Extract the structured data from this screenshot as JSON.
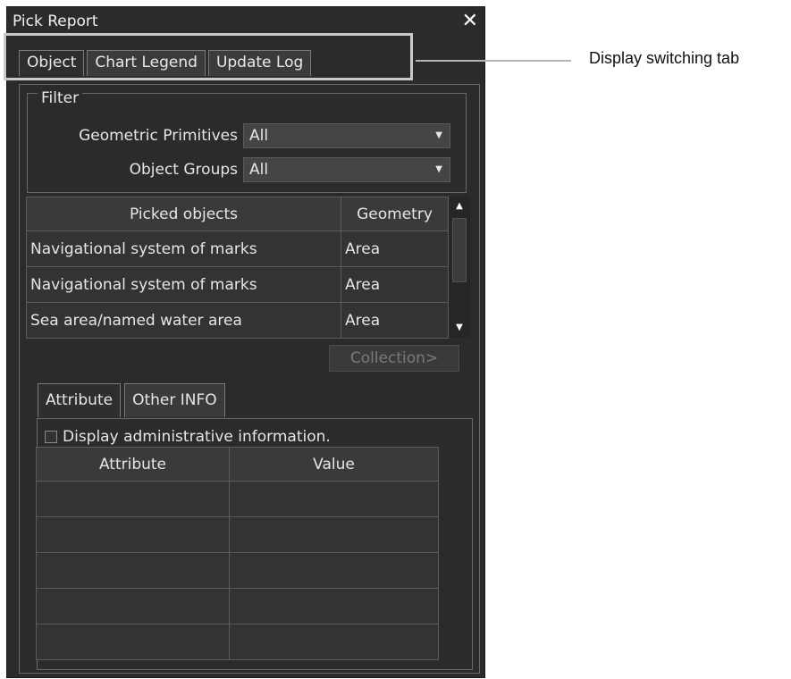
{
  "window": {
    "title": "Pick Report",
    "close_symbol": "✕"
  },
  "top_tabs": [
    {
      "label": "Object",
      "active": true
    },
    {
      "label": "Chart Legend",
      "active": false
    },
    {
      "label": "Update Log",
      "active": false
    }
  ],
  "callout": {
    "text": "Display switching tab"
  },
  "filter": {
    "legend": "Filter",
    "geometric_primitives": {
      "label": "Geometric Primitives",
      "value": "All"
    },
    "object_groups": {
      "label": "Object Groups",
      "value": "All"
    }
  },
  "objects_table": {
    "headers": [
      "Picked objects",
      "Geometry"
    ],
    "rows": [
      [
        "Navigational system of marks",
        "Area"
      ],
      [
        "Navigational system of marks",
        "Area"
      ],
      [
        "Sea area/named water area",
        "Area"
      ]
    ]
  },
  "collection_button": "Collection>",
  "bottom_tabs": [
    {
      "label": "Attribute",
      "active": true
    },
    {
      "label": "Other INFO",
      "active": false
    }
  ],
  "display_admin_checkbox": {
    "label": "Display administrative information.",
    "checked": false
  },
  "attribute_table": {
    "headers": [
      "Attribute",
      "Value"
    ],
    "rows": [
      [
        "",
        ""
      ],
      [
        "",
        ""
      ],
      [
        "",
        ""
      ],
      [
        "",
        ""
      ],
      [
        "",
        ""
      ]
    ]
  },
  "colors": {
    "window_bg": "#2b2b2b",
    "text": "#e6e6e6",
    "disabled_text": "#7a7a7a",
    "highlight_border": "#c9c9c9"
  }
}
